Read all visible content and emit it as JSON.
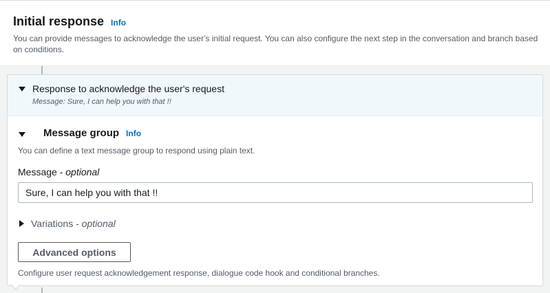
{
  "header": {
    "title": "Initial response",
    "info_label": "Info",
    "description": "You can provide messages to acknowledge the user's initial request. You can also configure the next step in the conversation and branch based on conditions."
  },
  "acknowledge": {
    "title": "Response to acknowledge the user's request",
    "subtitle": "Message: Sure, I can help you with that !!"
  },
  "message_group": {
    "title": "Message group",
    "info_label": "Info",
    "description": "You can define a text message group to respond using plain text.",
    "field_label": "Message - ",
    "field_optional": "optional",
    "message_value": "Sure, I can help you with that !!"
  },
  "variations": {
    "label": "Variations - ",
    "optional": "optional"
  },
  "advanced": {
    "button_label": "Advanced options",
    "description": "Configure user request acknowledgement response, dialogue code hook and conditional branches."
  }
}
